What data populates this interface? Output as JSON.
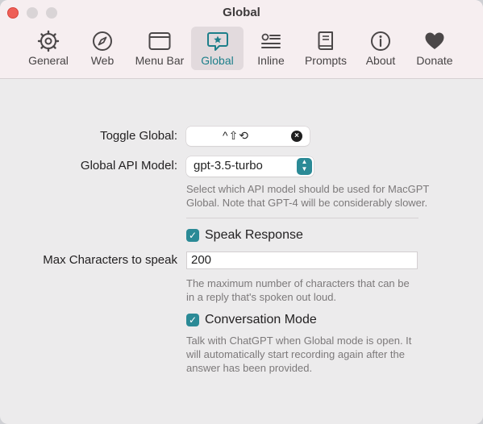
{
  "window": {
    "title": "Global"
  },
  "toolbar": {
    "tabs": [
      {
        "label": "General",
        "icon": "gear-icon"
      },
      {
        "label": "Web",
        "icon": "compass-icon"
      },
      {
        "label": "Menu Bar",
        "icon": "window-icon"
      },
      {
        "label": "Global",
        "icon": "star-bubble-icon",
        "active": true
      },
      {
        "label": "Inline",
        "icon": "list-icon"
      },
      {
        "label": "Prompts",
        "icon": "book-icon"
      },
      {
        "label": "About",
        "icon": "info-icon"
      },
      {
        "label": "Donate",
        "icon": "heart-icon"
      }
    ]
  },
  "form": {
    "toggle_global": {
      "label": "Toggle Global:",
      "shortcut": "^⇧⟲",
      "clear_glyph": "×"
    },
    "api_model": {
      "label": "Global API Model:",
      "value": "gpt-3.5-turbo",
      "help": [
        "Select which API model should be used for MacGPT",
        "Global. Note that GPT-4 will be considerably slower."
      ]
    },
    "speak_response": {
      "label": "Speak Response",
      "checked": true
    },
    "max_chars": {
      "label": "Max Characters to speak",
      "value": "200",
      "help": [
        "The maximum number of characters that can be",
        "in a reply that's spoken out loud."
      ]
    },
    "conversation_mode": {
      "label": "Conversation Mode",
      "checked": true,
      "help": [
        "Talk with ChatGPT when Global mode is open. It",
        "will automatically start recording again after the",
        "answer has been provided."
      ]
    }
  },
  "colors": {
    "accent": "#2b8a96",
    "close": "#ee5f57"
  }
}
